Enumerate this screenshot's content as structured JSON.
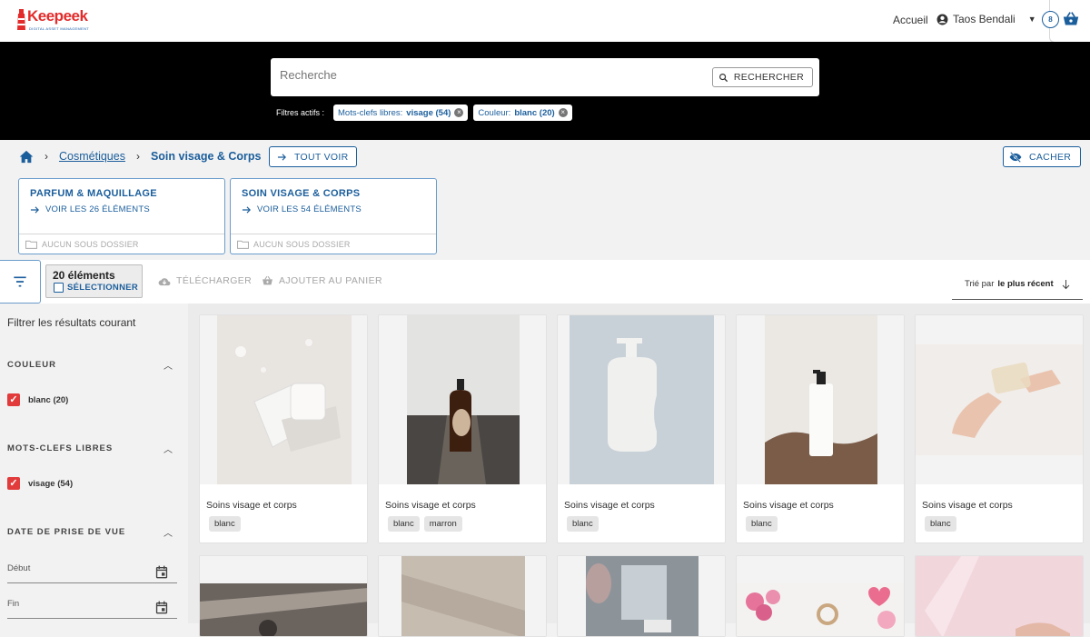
{
  "header": {
    "logo_text": "Keepeek",
    "logo_tagline": "DIGITAL ASSET MANAGEMENT",
    "nav_home": "Accueil",
    "user_name": "Taos Bendali",
    "cart_count": "8"
  },
  "search": {
    "placeholder": "Recherche",
    "button_label": "RECHERCHER",
    "filters_label": "Filtres actifs :",
    "chips": [
      {
        "key": "Mots-clefs libres:",
        "value": "visage (54)"
      },
      {
        "key": "Couleur:",
        "value": "blanc (20)"
      }
    ]
  },
  "breadcrumb": {
    "link": "Cosmétiques",
    "current": "Soin visage & Corps",
    "see_all": "TOUT VOIR",
    "hide": "CACHER"
  },
  "folders": [
    {
      "title": "PARFUM & MAQUILLAGE",
      "link": "VOIR LES 26 ÉLÉMENTS",
      "footer": "AUCUN SOUS DOSSIER"
    },
    {
      "title": "SOIN VISAGE & CORPS",
      "link": "VOIR LES 54 ÉLÉMENTS",
      "footer": "AUCUN SOUS DOSSIER"
    }
  ],
  "toolbar": {
    "count": "20 éléments",
    "select": "SÉLECTIONNER",
    "download": "TÉLÉCHARGER",
    "add_to_cart": "AJOUTER AU PANIER",
    "sort_prefix": "Trié par",
    "sort_value": "le plus récent"
  },
  "sidebar": {
    "heading": "Filtrer les résultats courant",
    "sections": [
      {
        "title": "COULEUR",
        "option": "blanc (20)"
      },
      {
        "title": "MOTS-CLEFS LIBRES",
        "option": "visage (54)"
      },
      {
        "title": "DATE DE PRISE DE VUE"
      }
    ],
    "date_start": "Début",
    "date_end": "Fin"
  },
  "cards": [
    {
      "title": "Soins visage et corps",
      "tags": [
        "blanc"
      ]
    },
    {
      "title": "Soins visage et corps",
      "tags": [
        "blanc",
        "marron"
      ]
    },
    {
      "title": "Soins visage et corps",
      "tags": [
        "blanc"
      ]
    },
    {
      "title": "Soins visage et corps",
      "tags": [
        "blanc"
      ]
    },
    {
      "title": "Soins visage et corps",
      "tags": [
        "blanc"
      ]
    }
  ],
  "colors": {
    "accent": "#1b5e9c",
    "brand_red": "#e32b2b",
    "checkbox_red": "#e23b3b"
  }
}
